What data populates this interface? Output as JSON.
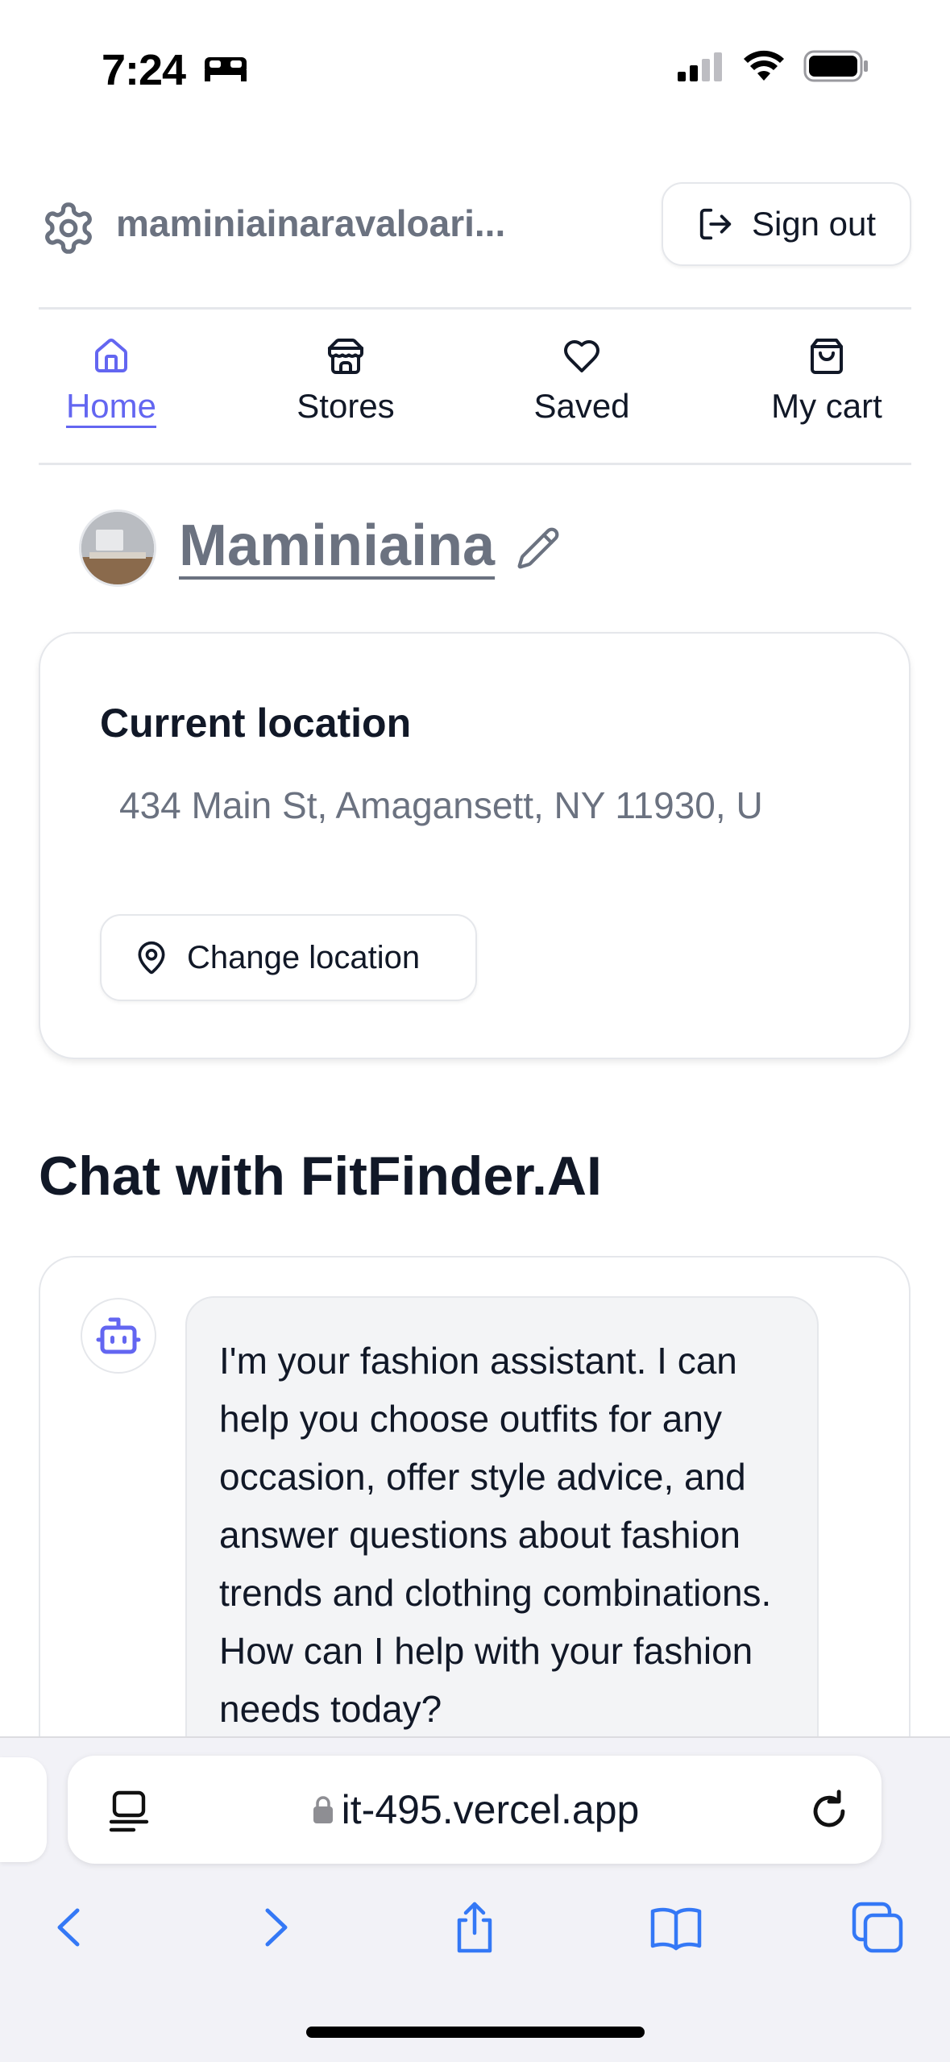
{
  "status_bar": {
    "time": "7:24"
  },
  "header": {
    "account_email": "maminiainaravaloari...",
    "sign_out_label": "Sign out"
  },
  "nav": {
    "items": [
      {
        "label": "Home",
        "icon": "home-icon",
        "active": true
      },
      {
        "label": "Stores",
        "icon": "store-icon",
        "active": false
      },
      {
        "label": "Saved",
        "icon": "heart-icon",
        "active": false
      },
      {
        "label": "My cart",
        "icon": "shopping-bag-icon",
        "active": false
      }
    ]
  },
  "profile": {
    "name": "Maminiaina"
  },
  "location": {
    "title": "Current location",
    "address": "434 Main St, Amagansett, NY 11930, U",
    "change_label": "Change location"
  },
  "chat": {
    "title": "Chat with FitFinder.AI",
    "bot_message": "I'm your fashion assistant. I can help you choose outfits for any occasion, offer style advice, and answer questions about fashion trends and clothing combinations. How can I help with your fashion needs today?"
  },
  "browser": {
    "url": "it-495.vercel.app"
  },
  "colors": {
    "accent": "#6366f1",
    "muted_text": "#6b7280",
    "safari_blue": "#3478f6"
  }
}
